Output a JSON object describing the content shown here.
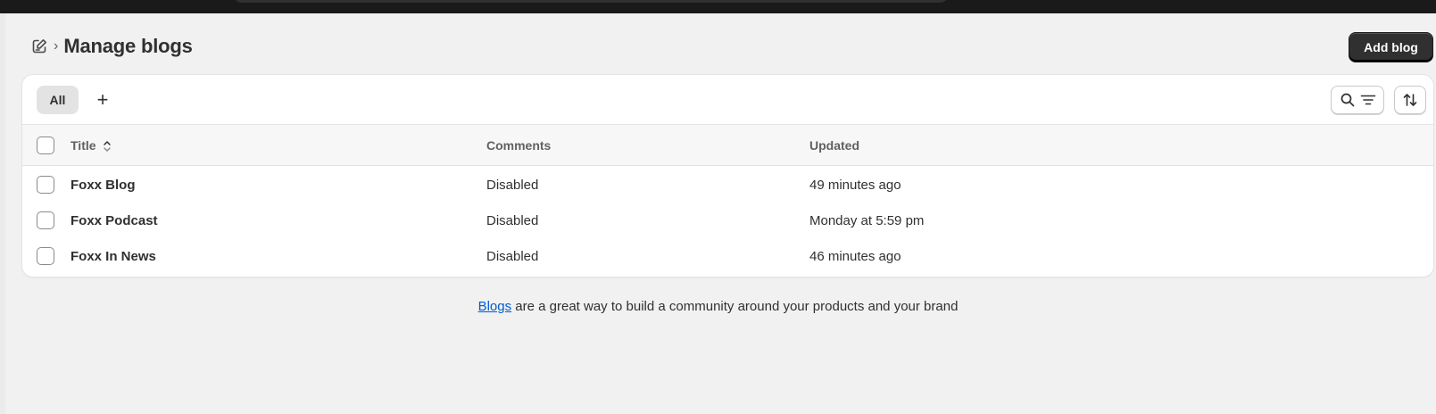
{
  "page": {
    "title": "Manage blogs",
    "add_button_label": "Add blog"
  },
  "tabs": {
    "all_label": "All",
    "add_symbol": "+"
  },
  "table": {
    "columns": {
      "title": "Title",
      "comments": "Comments",
      "updated": "Updated"
    },
    "rows": [
      {
        "title": "Foxx Blog",
        "comments": "Disabled",
        "updated": "49 minutes ago"
      },
      {
        "title": "Foxx Podcast",
        "comments": "Disabled",
        "updated": "Monday at 5:59 pm"
      },
      {
        "title": "Foxx In News",
        "comments": "Disabled",
        "updated": "46 minutes ago"
      }
    ]
  },
  "footer": {
    "link_text": "Blogs",
    "text": " are a great way to build a community around your products and your brand"
  },
  "icons": {
    "breadcrumb": "blog-edit-icon",
    "separator": "chevron-right-icon",
    "search": "search-icon",
    "filter": "filter-icon",
    "sort": "sort-icon"
  },
  "colors": {
    "primary_button": "#303030",
    "link": "#005bd3",
    "background": "#f1f1f1",
    "topbar": "#1a1a1a"
  }
}
